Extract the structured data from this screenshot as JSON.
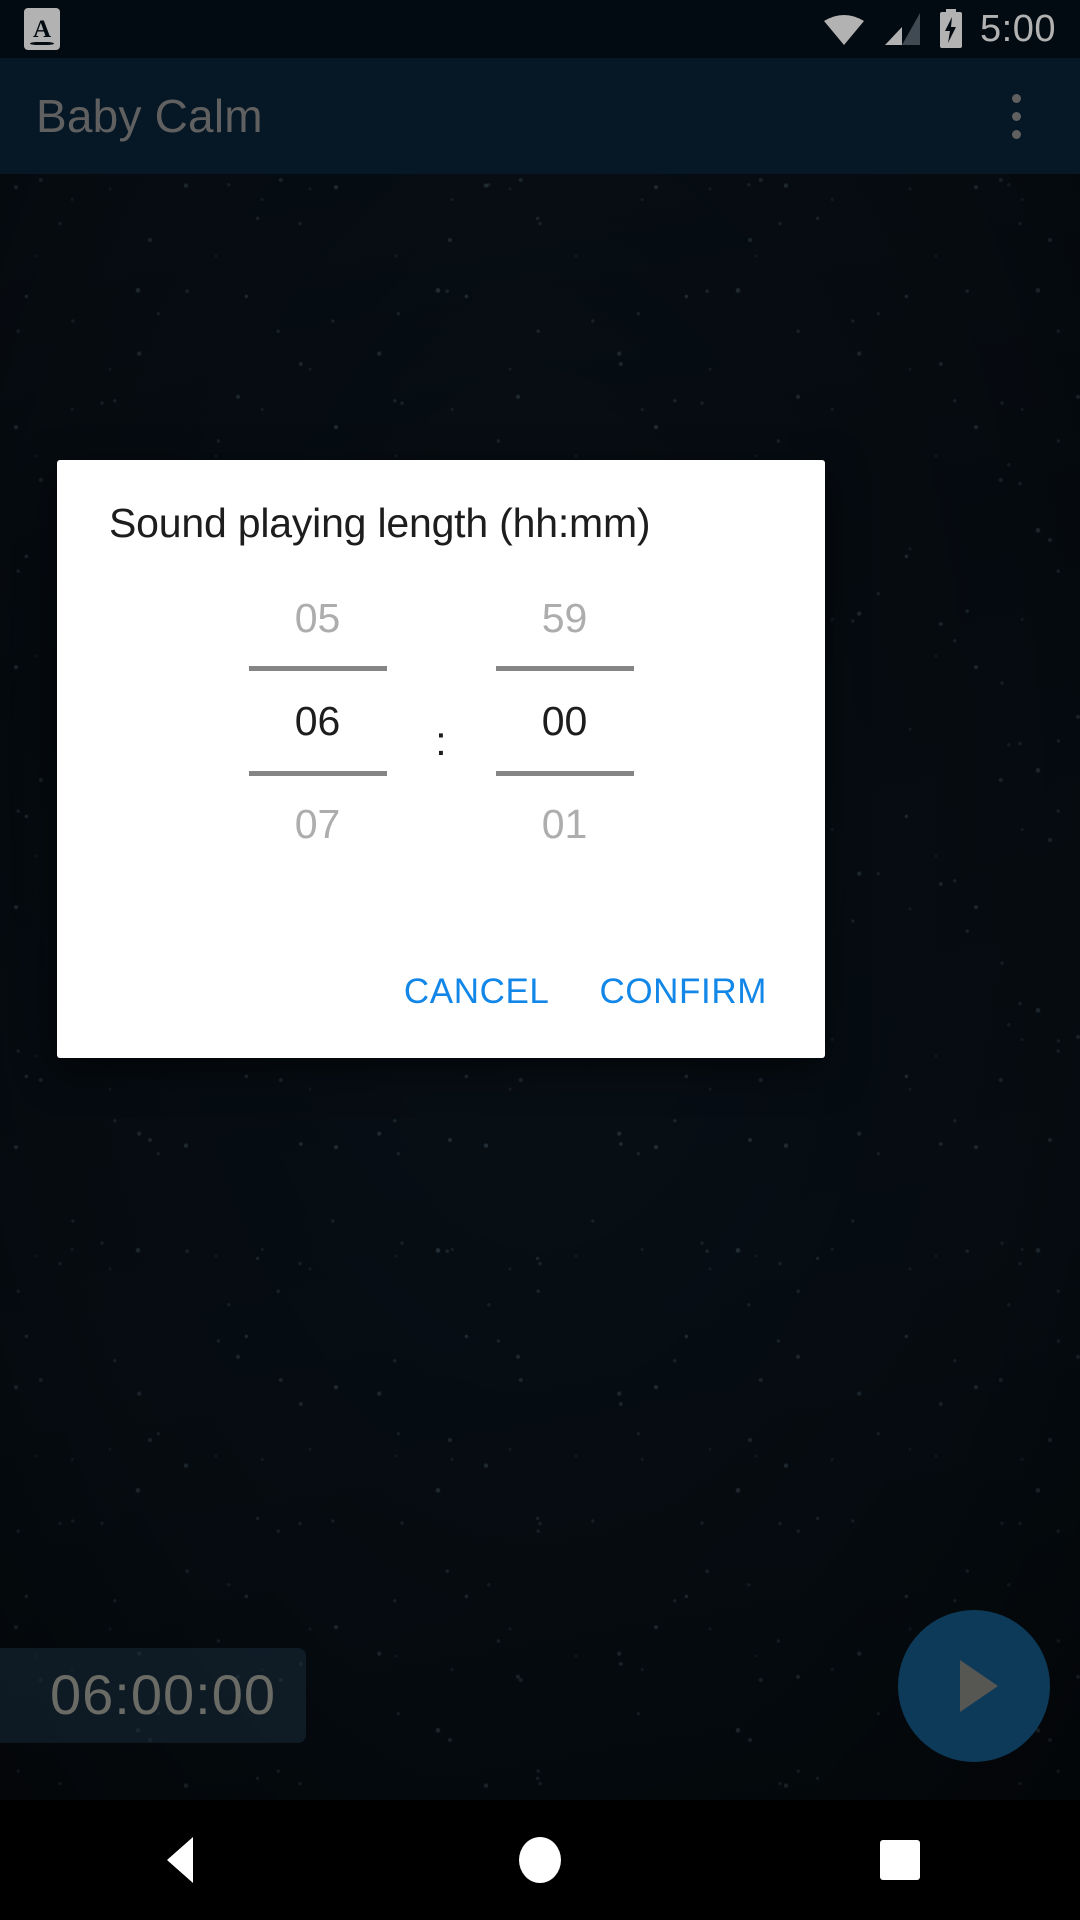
{
  "status_bar": {
    "app_badge_letter": "A",
    "icons": [
      "wifi-icon",
      "cellular-signal-icon",
      "battery-charging-icon"
    ],
    "time": "5:00"
  },
  "app_bar": {
    "title": "Baby Calm",
    "overflow_icon": "more-vert-icon"
  },
  "background": {
    "timer_readout": "06:00:00",
    "fab_icon": "play-icon",
    "fab_color": "#14537f",
    "app_bar_color": "#0a2235"
  },
  "dialog": {
    "title": "Sound playing length (hh:mm)",
    "separator": ":",
    "hours": {
      "previous": "05",
      "selected": "06",
      "next": "07"
    },
    "minutes": {
      "previous": "59",
      "selected": "00",
      "next": "01"
    },
    "cancel_label": "CANCEL",
    "confirm_label": "CONFIRM",
    "action_color": "#1287e8"
  },
  "nav_bar": {
    "back_icon": "back-triangle-icon",
    "home_icon": "home-circle-icon",
    "recents_icon": "recents-square-icon"
  }
}
